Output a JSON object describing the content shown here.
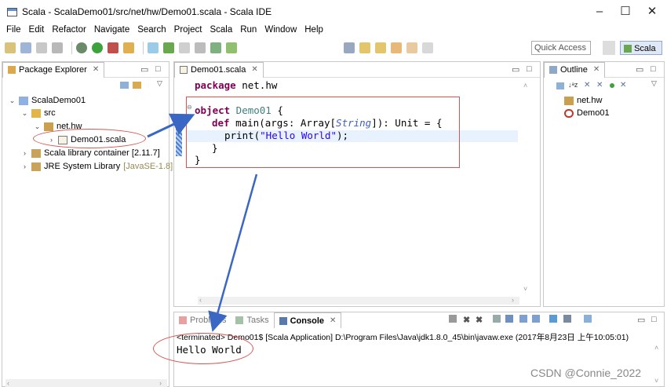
{
  "window": {
    "title": "Scala - ScalaDemo01/src/net/hw/Demo01.scala - Scala IDE",
    "minimize": "–",
    "maximize": "☐",
    "close": "✕"
  },
  "menu": [
    "File",
    "Edit",
    "Refactor",
    "Navigate",
    "Search",
    "Project",
    "Scala",
    "Run",
    "Window",
    "Help"
  ],
  "toolbar": {
    "quick_access": "Quick Access",
    "perspective_label": "Scala"
  },
  "package_explorer": {
    "tab_label": "Package Explorer",
    "tree": {
      "project": "ScalaDemo01",
      "src": "src",
      "package": "net.hw",
      "file": "Demo01.scala",
      "scala_lib": "Scala library container [2.11.7]",
      "jre_lib": "JRE System Library",
      "jre_version": "[JavaSE-1.8]"
    }
  },
  "editor": {
    "tab_label": "Demo01.scala",
    "code": {
      "line1_kw": "package",
      "line1_rest": " net.hw",
      "line2_kw": "object",
      "line2_name": " Demo01",
      "line2_rest": " {",
      "line3_kw": "def",
      "line3_a": " main(args: Array[",
      "line3_type": "String",
      "line3_b": "]): Unit = {",
      "line4_a": "print(",
      "line4_str": "\"Hello World\"",
      "line4_b": ");",
      "line5": "}",
      "line6": "}"
    }
  },
  "outline": {
    "tab_label": "Outline",
    "items": [
      "net.hw",
      "Demo01"
    ]
  },
  "console": {
    "tabs": [
      "Problems",
      "Tasks",
      "Console"
    ],
    "status": "<terminated> Demo01$ [Scala Application] D:\\Program Files\\Java\\jdk1.8.0_45\\bin\\javaw.exe (2017年8月23日 上午10:05:01)",
    "output": "Hello World"
  },
  "watermark": "CSDN @Connie_2022",
  "colors": {
    "keyword": "#7f0055",
    "string": "#2a00ff",
    "annotation": "#d9534f",
    "arrow": "#3a67c4"
  }
}
